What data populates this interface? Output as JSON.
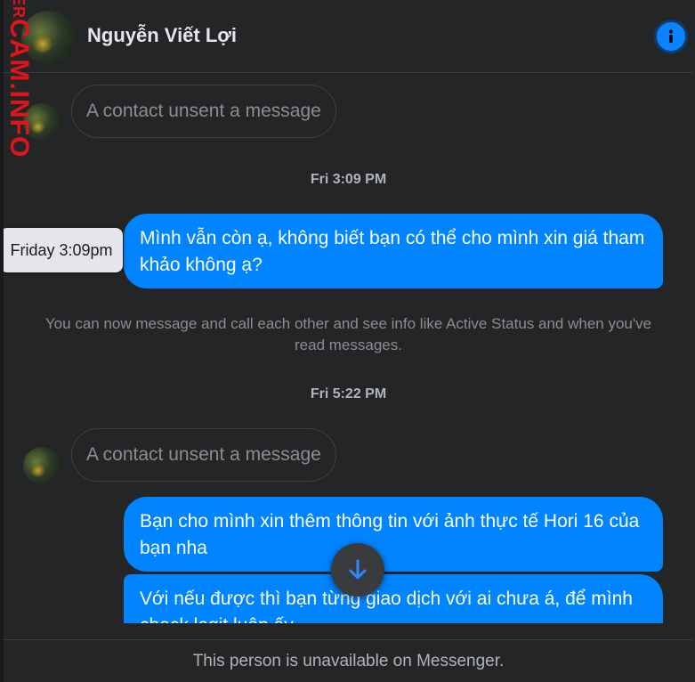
{
  "header": {
    "contact_name": "Nguyễn Viết Lợi",
    "info_icon": "info-icon"
  },
  "watermark": {
    "text_small": "ER",
    "text_large": "CAM.INFO"
  },
  "thread": {
    "unsent_1": "A contact unsent a message",
    "timestamp_1": "Fri 3:09 PM",
    "message_1": "Mình vẫn còn ạ, không biết bạn có thể cho mình xin giá tham khảo không ạ?",
    "tooltip_1": "Friday 3:09pm",
    "system_note": "You can now message and call each other and see info like Active Status and when you've read messages.",
    "timestamp_2": "Fri 5:22 PM",
    "unsent_2": "A contact unsent a message",
    "message_2": "Bạn cho mình xin thêm thông tin với ảnh thực tế Hori 16 của bạn nha",
    "message_3": "Với nếu được thì bạn từng giao dịch với ai chưa á, để mình check legit luôn ấy"
  },
  "footer": {
    "status": "This person is unavailable on Messenger."
  },
  "colors": {
    "background": "#242526",
    "bubble": "#0084ff",
    "accent": "#0a84ff",
    "watermark": "#e0141c"
  }
}
